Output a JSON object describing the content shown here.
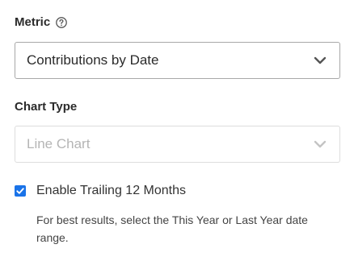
{
  "metric": {
    "label": "Metric",
    "help_icon": "question-circle-icon",
    "selected_value": "Contributions by Date",
    "chevron_icon": "chevron-down-icon"
  },
  "chart_type": {
    "label": "Chart Type",
    "selected_value": "Line Chart",
    "disabled": true,
    "chevron_icon": "chevron-down-icon"
  },
  "trailing": {
    "checked": true,
    "label": "Enable Trailing 12 Months",
    "helper_text": "For best results, select the This Year or Last Year date range."
  },
  "colors": {
    "accent": "#1a73e8",
    "border": "#a8a8a8",
    "disabled_border": "#dddddd",
    "disabled_text": "#b5b5b5"
  }
}
